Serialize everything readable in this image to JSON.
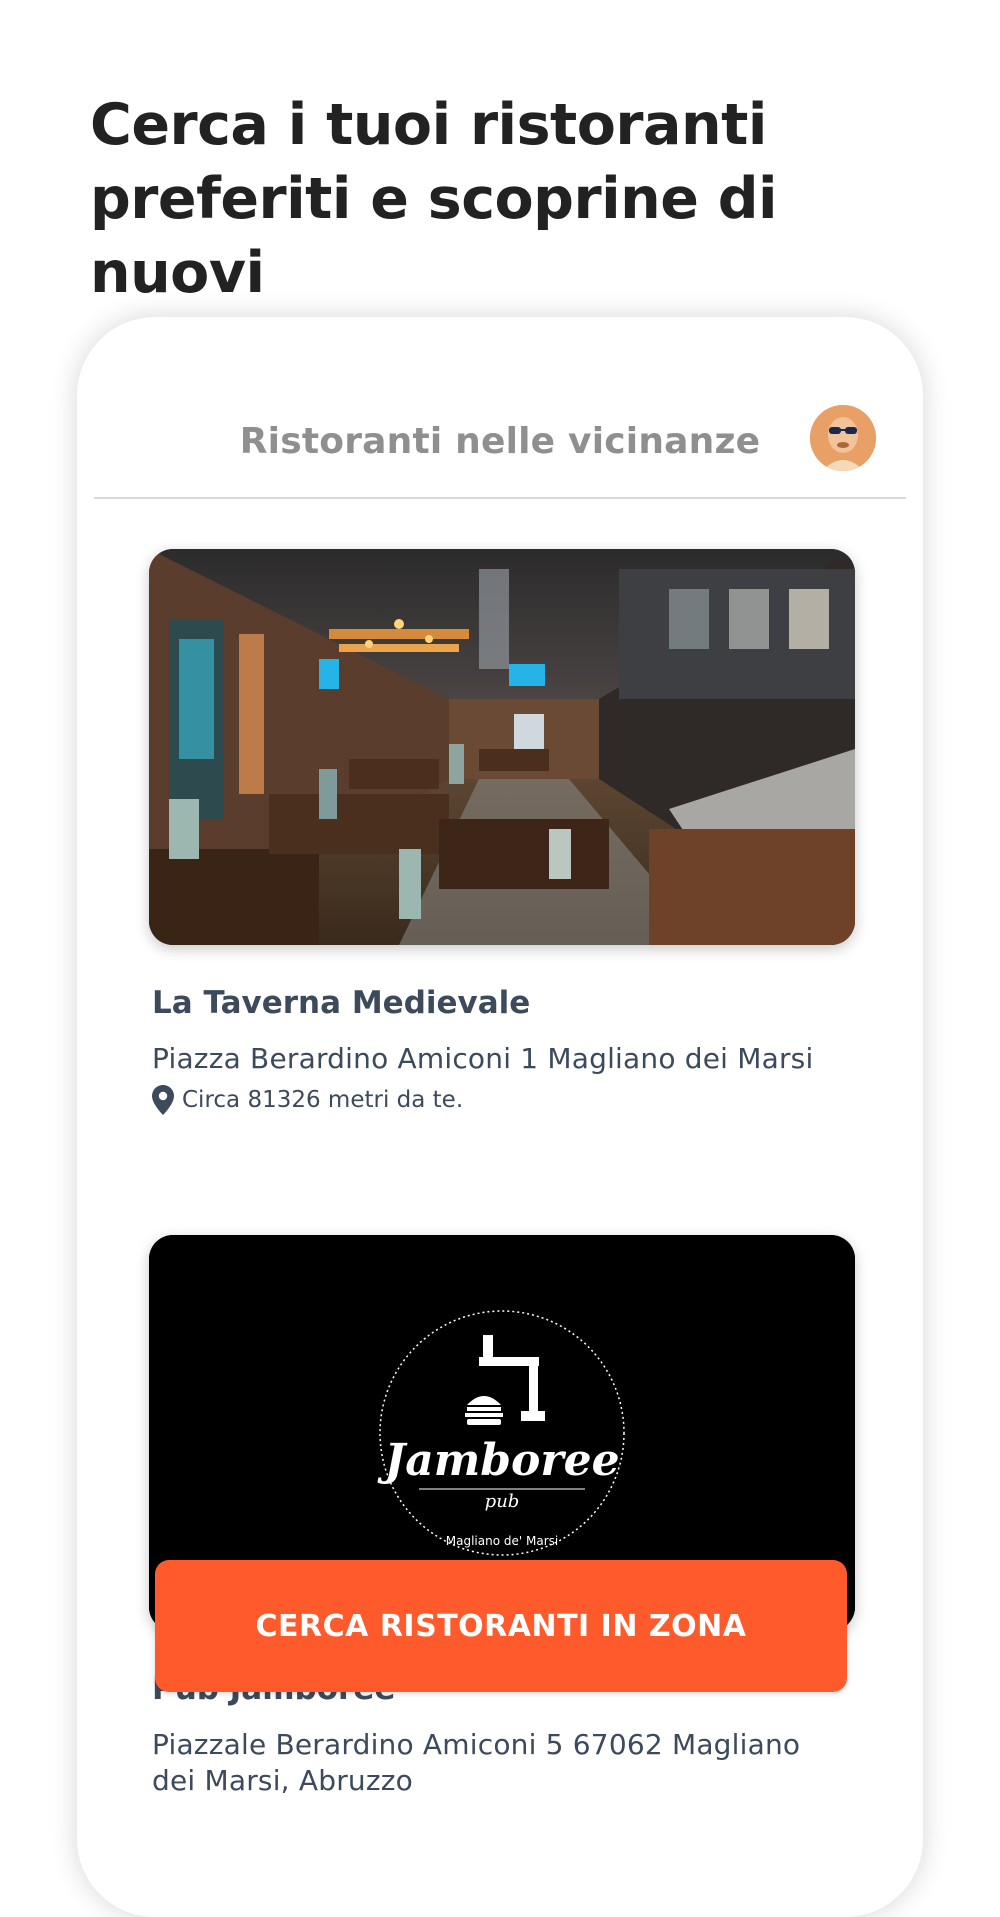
{
  "headline": {
    "line1": "Cerca i tuoi ristoranti",
    "line2": "preferiti e scoprine di nuovi"
  },
  "app": {
    "title": "Ristoranti nelle vicinanze",
    "avatar_icon": "user-avatar"
  },
  "restaurants": [
    {
      "name": "La Taverna Medievale",
      "address": "Piazza Berardino Amiconi 1 Magliano dei Marsi",
      "distance": "Circa 81326 metri da te."
    },
    {
      "name": "Pub Jamboree",
      "address_line1": "Piazzale Berardino Amiconi 5 67062 Magliano",
      "address_line2": "dei Marsi, Abruzzo",
      "logo_text": "Jamboree",
      "logo_sub": "pub",
      "logo_place": "Magliano de' Marsi"
    }
  ],
  "cta": {
    "label": "CERCA RISTORANTI IN ZONA"
  },
  "colors": {
    "accent": "#ff5a2c",
    "text_dark": "#222222",
    "text_card": "#3c4a5c",
    "muted": "#8f8f8f"
  }
}
